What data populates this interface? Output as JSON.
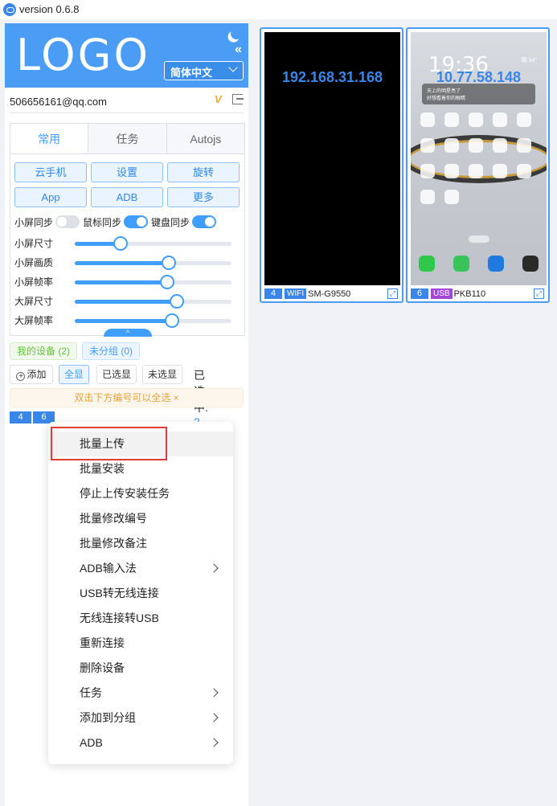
{
  "window": {
    "title": "version 0.6.8"
  },
  "header": {
    "logo": "LOGO",
    "language": "简体中文"
  },
  "account": {
    "email": "506656161@qq.com"
  },
  "tabs": [
    {
      "label": "常用",
      "active": true
    },
    {
      "label": "任务",
      "active": false
    },
    {
      "label": "Autojs",
      "active": false
    }
  ],
  "quick_buttons": [
    "云手机",
    "设置",
    "旋转",
    "App",
    "ADB",
    "更多"
  ],
  "sync": [
    {
      "label": "小屏同步",
      "on": false
    },
    {
      "label": "鼠标同步",
      "on": true
    },
    {
      "label": "键盘同步",
      "on": true
    }
  ],
  "sliders": [
    {
      "label": "小屏尺寸",
      "value": 0.29
    },
    {
      "label": "小屏画质",
      "value": 0.6
    },
    {
      "label": "小屏帧率",
      "value": 0.59
    },
    {
      "label": "大屏尺寸",
      "value": 0.65
    },
    {
      "label": "大屏帧率",
      "value": 0.62
    }
  ],
  "groups": {
    "my_devices": "我的设备 (2)",
    "ungrouped": "未分组 (0)"
  },
  "filters": {
    "add": "添加",
    "show_all": "全显",
    "selected": "已选显",
    "unselected": "未选显"
  },
  "selected_count": {
    "label": "已选中:",
    "value": "2"
  },
  "notice": "双击下方编号可以全选 ×",
  "device_numbers": [
    "4",
    "6"
  ],
  "context_menu": [
    {
      "label": "批量上传",
      "submenu": false
    },
    {
      "label": "批量安装",
      "submenu": false
    },
    {
      "label": "停止上传安装任务",
      "submenu": false
    },
    {
      "label": "批量修改编号",
      "submenu": false
    },
    {
      "label": "批量修改备注",
      "submenu": false
    },
    {
      "label": "ADB输入法",
      "submenu": true
    },
    {
      "label": "USB转无线连接",
      "submenu": false
    },
    {
      "label": "无线连接转USB",
      "submenu": false
    },
    {
      "label": "重新连接",
      "submenu": false
    },
    {
      "label": "删除设备",
      "submenu": false
    },
    {
      "label": "任务",
      "submenu": true
    },
    {
      "label": "添加到分组",
      "submenu": true
    },
    {
      "label": "ADB",
      "submenu": true
    }
  ],
  "devices": [
    {
      "ip": "192.168.31.168",
      "number": "4",
      "connection": "WIFI",
      "model": "SM-G9550"
    },
    {
      "ip": "10.77.58.148",
      "number": "6",
      "connection": "USB",
      "model": "PKB110",
      "clock": "19:36",
      "weather": "晴 34°",
      "note_line1": "天上的明星亮了",
      "note_line2": "好想看着你的眼睛"
    }
  ],
  "colors": {
    "accent": "#409eff",
    "header": "#4a9cf5",
    "highlight": "#e53935",
    "usb": "#a347d8"
  }
}
